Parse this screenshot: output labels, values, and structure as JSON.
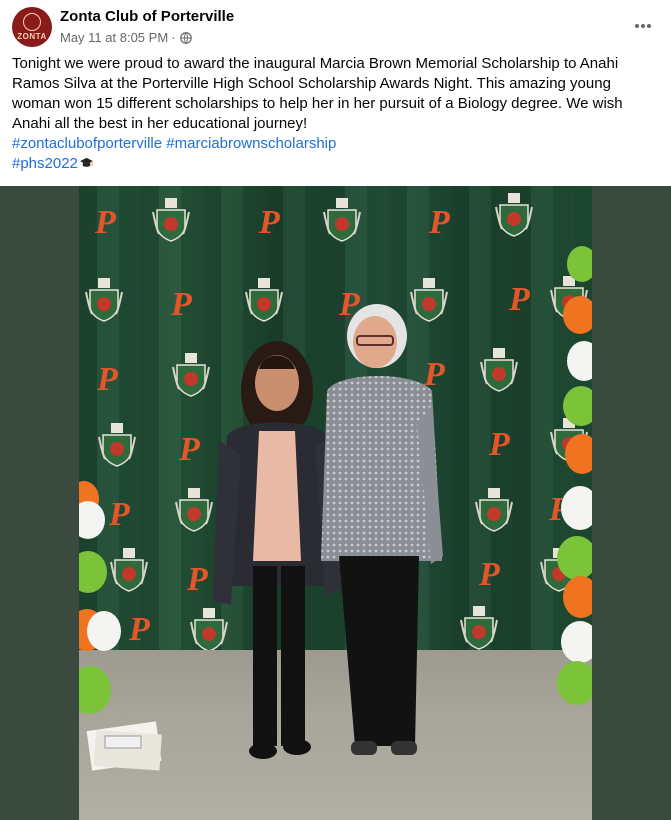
{
  "post": {
    "page_name": "Zonta Club of Porterville",
    "avatar_text": "ZONTA",
    "date": "May 11 at 8:05 PM",
    "separator": "·",
    "privacy_icon": "globe-icon",
    "more_icon": "more-options-icon",
    "body": "Tonight we were proud to award the inaugural Marcia Brown Memorial Scholarship to Anahi Ramos Silva at the Porterville High School Scholarship Awards Night. This amazing young woman won 15 different scholarships to help her in her pursuit of a Biology degree. We wish Anahi all the best in her educational journey!",
    "hashtags_line1": [
      "#zontaclubofporterville",
      "#marciabrownscholarship"
    ],
    "hashtag_line2": "#phs2022",
    "emoji": "graduation-cap-emoji"
  },
  "photo": {
    "subject": "photo of two women standing in front of a green Porterville backdrop",
    "backdrop_letter": "P",
    "colors": {
      "backdrop": "#1f4a33",
      "letter": "#e2562a",
      "balloon_orange": "#f0731f",
      "balloon_white": "#f4f4f2",
      "balloon_green": "#7bc43a"
    }
  },
  "colors": {
    "hashtag": "#216fdb",
    "meta": "#65676b",
    "text": "#050505"
  }
}
